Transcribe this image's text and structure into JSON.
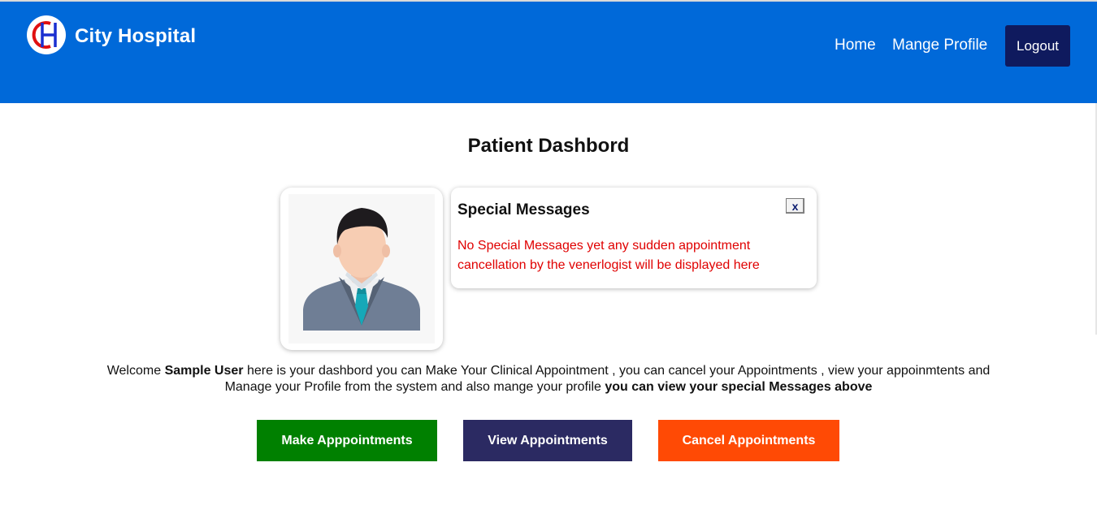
{
  "brand": {
    "name": "City Hospital",
    "logo_icon": "city-hospital-logo-icon"
  },
  "nav": {
    "home": "Home",
    "profile": "Mange Profile",
    "logout": "Logout"
  },
  "page": {
    "title": "Patient Dashbord"
  },
  "messages": {
    "title": "Special Messages",
    "close": "x",
    "body": "No Special Messages yet any sudden appointment cancellation by the venerlogist will be displayed here"
  },
  "welcome": {
    "prefix": "Welcome ",
    "user": "Sample User",
    "middle": " here is your dashbord you can Make Your Clinical Appointment , you can cancel your Appointments , view your appoinmtents and Manage your Profile from the system and also mange your profile ",
    "emphasis": "you can view your special Messages above"
  },
  "actions": {
    "make": "Make Apppointments",
    "view": "View Appointments",
    "cancel": "Cancel Appointments"
  },
  "colors": {
    "navbar": "#0069d9",
    "logout": "#0f1a5e",
    "make": "#008000",
    "view": "#2b2a62",
    "cancel": "#ff4a05",
    "message_text": "#e00000"
  }
}
